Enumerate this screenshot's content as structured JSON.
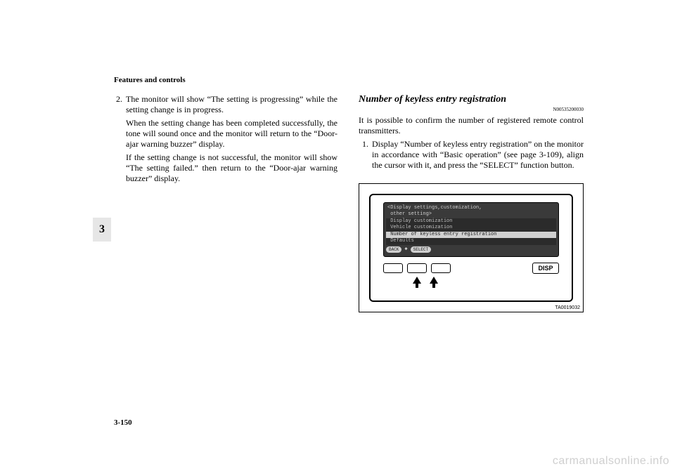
{
  "header": "Features and controls",
  "sideTab": "3",
  "pageNum": "3-150",
  "watermark": "carmanualsonline.info",
  "left": {
    "num": "2.",
    "p1": "The monitor will show “The setting is progressing” while the setting change is in progress.",
    "p2": "When the setting change has been completed successfully, the tone will sound once and the monitor will return to the “Door-ajar warning buzzer” display.",
    "p3": "If the setting change is not successful, the monitor will show “The setting failed.” then return to the “Door-ajar warning buzzer” display."
  },
  "right": {
    "heading": "Number of keyless entry registration",
    "refcode": "N00535200030",
    "intro": "It is possible to confirm the number of registered remote control transmitters.",
    "step_num": "1.",
    "step_body": "Display “Number of keyless entry registration” on the monitor in accordance with “Basic operation” (see page 3-109), align the cursor with it, and press the “SELECT” function button."
  },
  "figure": {
    "title1": "<Display settings,customization,",
    "title2": " other setting>",
    "item1": " Display customization",
    "item2": " Vehicle customization",
    "item3": " Number of keyless entry registration",
    "item4": " Defaults",
    "back": "BACK",
    "select": "SELECT",
    "disp": "DISP",
    "id": "TA0019032"
  }
}
